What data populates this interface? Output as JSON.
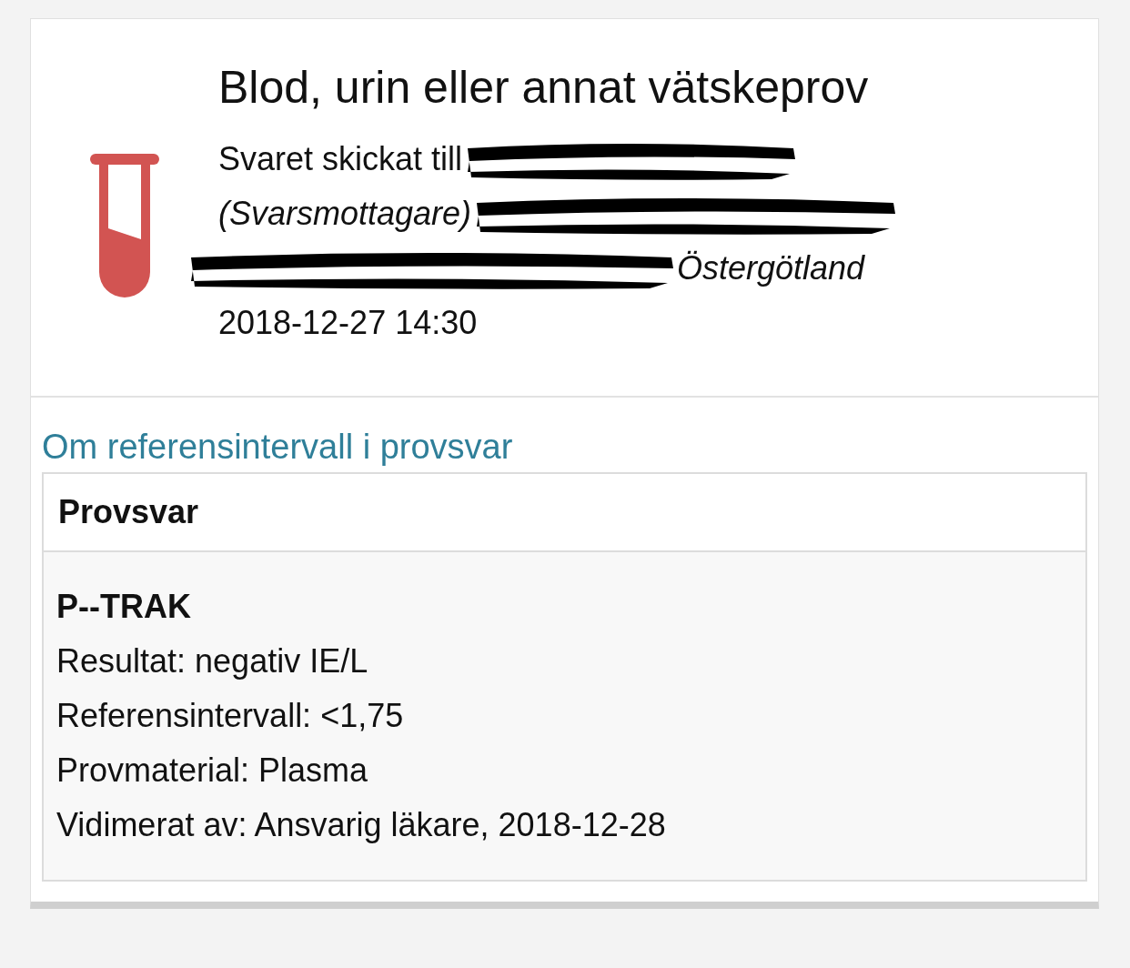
{
  "header": {
    "title": "Blod, urin eller annat vätskeprov",
    "sent_to_label": "Svaret skickat till",
    "recipient_role": "(Svarsmottagare)",
    "region": "Östergötland",
    "datetime": "2018-12-27 14:30"
  },
  "reference_link": "Om referensintervall i provsvar",
  "results": {
    "heading": "Provsvar",
    "test_name": "P--TRAK",
    "lines": [
      "Resultat: negativ IE/L",
      "Referensintervall: <1,75",
      "Provmaterial: Plasma",
      "Vidimerat av: Ansvarig läkare, 2018-12-28"
    ]
  }
}
